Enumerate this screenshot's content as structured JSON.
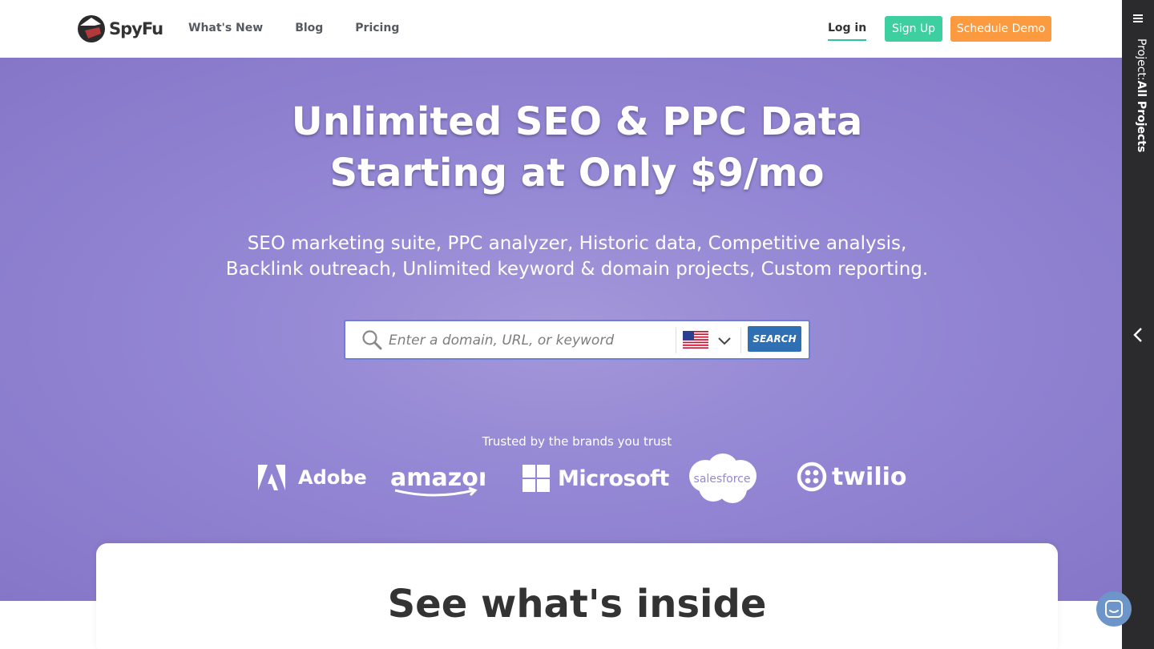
{
  "header": {
    "logo_text": "SpyFu",
    "nav": [
      "What's New",
      "Blog",
      "Pricing"
    ],
    "login_label": "Log in",
    "signup_label": "Sign Up",
    "demo_label": "Schedule Demo"
  },
  "hero": {
    "headline_line1": "Unlimited SEO & PPC Data",
    "headline_line2": "Starting at Only $9/mo",
    "subhead_line1": "SEO marketing suite, PPC analyzer, Historic data, Competitive analysis,",
    "subhead_line2": "Backlink outreach, Unlimited keyword & domain projects, Custom reporting.",
    "search_placeholder": "Enter a domain, URL, or keyword",
    "search_button": "SEARCH",
    "country": "us-flag-icon",
    "trusted_label": "Trusted by the brands you trust",
    "brands": [
      "Adobe",
      "amazon",
      "Microsoft",
      "salesforce",
      "twilio"
    ]
  },
  "card": {
    "title": "See what's inside"
  },
  "sidebar": {
    "project_prefix": "Project:",
    "project_name": "All Projects"
  },
  "colors": {
    "hero_bg": "#9487d4",
    "signup": "#3ecfa1",
    "demo": "#fc9a3f",
    "search_button": "#2f6fb3",
    "sidebar": "#2b2b2d"
  }
}
